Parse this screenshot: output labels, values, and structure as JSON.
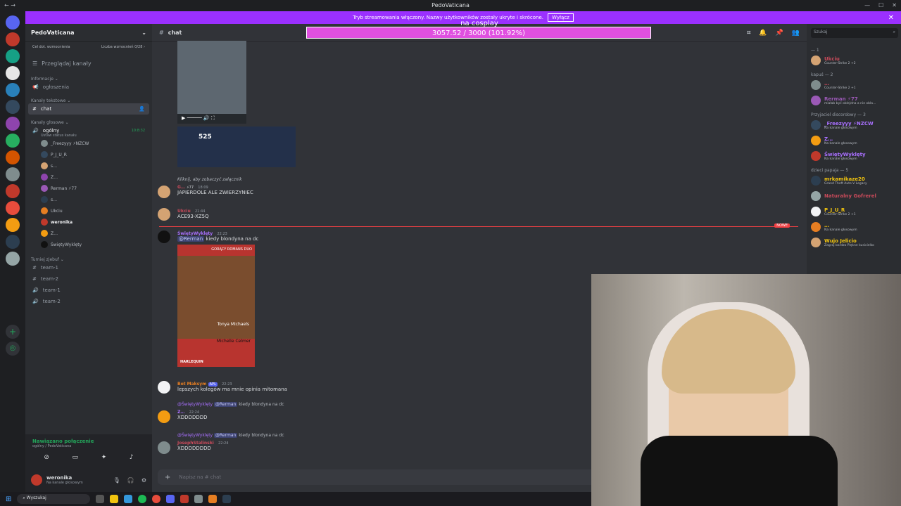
{
  "window": {
    "title": "PedoVaticana",
    "controls": [
      "—",
      "☐",
      "✕"
    ]
  },
  "streamer_bar": {
    "text": "Tryb streamowania włączony. Nazwy użytkowników zostały ukryte i skrócone.",
    "button": "Wyłącz"
  },
  "overlay": {
    "label": "na cosplay",
    "progress_text": "3057.52 / 3000 (101.92%)",
    "progress_fraction": 1.0192
  },
  "server": {
    "name": "PedoVaticana",
    "boost_goal": "Cel dot. wzmocnienia",
    "boost_count": "Liczba wzmocnień 0/28 ›",
    "browse": "Przeglądaj kanały"
  },
  "categories": {
    "info": "Informacje ⌄",
    "text": "Kanały tekstowe ⌄",
    "voice": "Kanały głosowe ⌄",
    "tourney": "Turniej zjebuf ⌄"
  },
  "channels": {
    "announcements": "ogłoszenia",
    "chat": "chat",
    "voice_general": "ogólny",
    "voice_timer": "10:8:32",
    "voice_hint": "Ustaw status kanału",
    "team1": "team-1",
    "team2": "team-2",
    "team3": "team-1",
    "team4": "team-2"
  },
  "voice_users": [
    "_Freezyyy ⚡NZCW",
    "P_J_U_R",
    "s…",
    "Z…",
    "Rerman ⚡77",
    "s…",
    "Ukciu",
    "weronika",
    "Z…",
    "ŚwiętyWyklęty"
  ],
  "connection": {
    "status": "Nawiązano połączenie",
    "where": "ogólny / PedoVaticana"
  },
  "me": {
    "name": "weronika",
    "status": "Na kanale głosowym"
  },
  "chat": {
    "channel": "chat",
    "video_count": "525",
    "m1_reply": "Kliknij, aby zobaczyć załącznik",
    "m1_name": "G…",
    "m1_tag": "⚡77",
    "m1_time": "18:09",
    "m1_text": "JAPIERDOLE ALE ZWIERZYNIEC",
    "m2_name": "Ukciu",
    "m2_time": "21:44",
    "m2_text": "ACE93-XZ5Q",
    "new_tag": "NOWE",
    "m3_name": "ŚwiętyWyklęty",
    "m3_time": "22:23",
    "m3_mention": "@Rerman",
    "m3_text": "kiedy blondyna na dc",
    "book_top": "GORĄCY ROMANS DUO",
    "book_author1": "Tonya Michaels",
    "book_author2": "Michelle Celmer",
    "book_brand": "HARLEQUIN",
    "m4_name": "Bot Maksym",
    "m4_badge": "APL",
    "m4_time": "22:23",
    "m4_text": "lepszych kolegów ma mnie opinia mitomana",
    "m5_reply_name": "@ŚwiętyWyklęty",
    "m5_reply_mention": "@Rerman",
    "m5_reply_text": "kiedy blondyna na dc",
    "m5_name": "Z…",
    "m5_time": "22:24",
    "m5_text": "XDDDDDDD",
    "m6_reply_name": "@ŚwiętyWyklęty",
    "m6_reply_mention": "@Rerman",
    "m6_reply_text": "kiedy blondyna na dc",
    "m6_name": "JosephStalinski",
    "m6_time": "22:24",
    "m6_text": "XDDDDDDDD",
    "composer_placeholder": "Napisz na #  chat"
  },
  "members": {
    "search": "Szukaj",
    "groups": [
      {
        "title": "— 1",
        "items": [
          {
            "name": "Ukciu",
            "status": "Counter-Strike 2 +2",
            "color": "#c94a5a"
          }
        ]
      },
      {
        "title": "kapuś — 2",
        "items": [
          {
            "name": "…",
            "status": "Counter-Strike 2 +1",
            "color": "#c94a5a"
          },
          {
            "name": "Rerman ⚡77",
            "status": "miałab być oblejdna a nie obla…",
            "color": "#9b59b6"
          }
        ]
      },
      {
        "title": "Przyjaciel discordowy — 3",
        "items": [
          {
            "name": "_Freezyyy ⚡NZCW",
            "status": "Na kanale głosowym",
            "color": "#a970ff"
          },
          {
            "name": "Z…",
            "status": "Na kanale głosowym",
            "color": "#a970ff"
          },
          {
            "name": "ŚwiętyWyklęty",
            "status": "Na kanale głosowym",
            "color": "#a970ff"
          }
        ]
      },
      {
        "title": "dzieci papaja — 5",
        "items": [
          {
            "name": "mrkamikaze20",
            "status": "Grand Theft Auto V Legacy",
            "color": "#f1c40f"
          },
          {
            "name": "Naturalny Gofrerel",
            "status": "",
            "color": "#c94a5a"
          },
          {
            "name": "P_J_U_R",
            "status": "Counter-Strike 2 +1",
            "color": "#f1c40f"
          },
          {
            "name": "…",
            "status": "Na kanale głosowym",
            "color": "#f1c40f"
          },
          {
            "name": "Wujo Jelicio",
            "status": "Zagraj bardzo Piękne kusicielko",
            "color": "#f1c40f"
          }
        ]
      }
    ]
  },
  "taskbar": {
    "search": "Wyszukaj"
  },
  "colors": {
    "accent": "#9b30ff",
    "overlay": "#e050e0",
    "online": "#23a55a",
    "new": "#f23f43"
  }
}
